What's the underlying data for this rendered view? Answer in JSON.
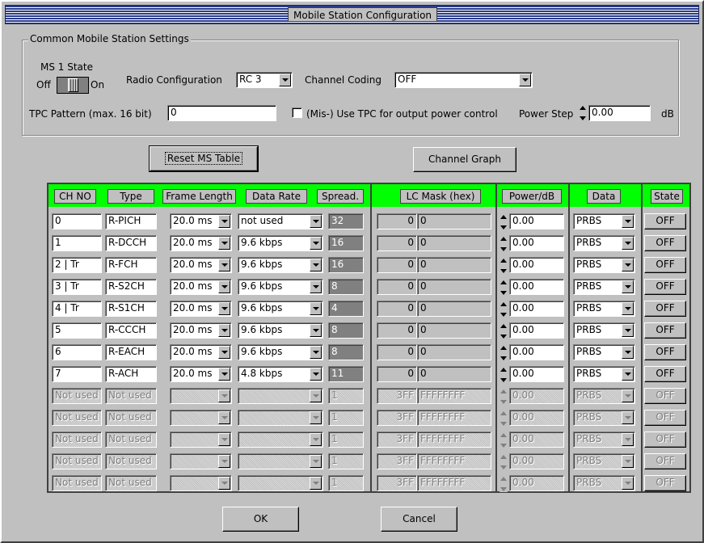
{
  "window": {
    "title": "Mobile Station Configuration"
  },
  "common": {
    "group_title": "Common Mobile Station Settings",
    "ms_state": {
      "label": "MS 1 State",
      "off": "Off",
      "on": "On"
    },
    "radio_config": {
      "label": "Radio Configuration",
      "value": "RC 3"
    },
    "channel_coding": {
      "label": "Channel Coding",
      "value": "OFF"
    },
    "tpc_pattern": {
      "label": "TPC Pattern (max. 16 bit)",
      "value": "0"
    },
    "mis_use_tpc": {
      "label": "(Mis-) Use TPC for output power control",
      "checked": false
    },
    "power_step": {
      "label": "Power Step",
      "value": "0.00",
      "unit": "dB"
    }
  },
  "buttons": {
    "reset": "Reset MS Table",
    "graph": "Channel Graph",
    "ok": "OK",
    "cancel": "Cancel"
  },
  "table": {
    "headers": {
      "ch_no": "CH NO",
      "type": "Type",
      "frame_length": "Frame Length",
      "data_rate": "Data Rate",
      "spread": "Spread.",
      "lc_mask": "LC Mask (hex)",
      "power": "Power/dB",
      "data": "Data",
      "state": "State"
    },
    "rows": [
      {
        "ch": "0",
        "type": "R-PICH",
        "frame": "20.0 ms",
        "rate": "not used",
        "spread": "32",
        "lc_a": "0",
        "lc_b": "0",
        "power": "0.00",
        "data": "PRBS",
        "state": "OFF"
      },
      {
        "ch": "1",
        "type": "R-DCCH",
        "frame": "20.0 ms",
        "rate": "9.6 kbps",
        "spread": "16",
        "lc_a": "0",
        "lc_b": "0",
        "power": "0.00",
        "data": "PRBS",
        "state": "OFF"
      },
      {
        "ch": "2 | Tr",
        "type": "R-FCH",
        "frame": "20.0 ms",
        "rate": "9.6 kbps",
        "spread": "16",
        "lc_a": "0",
        "lc_b": "0",
        "power": "0.00",
        "data": "PRBS",
        "state": "OFF"
      },
      {
        "ch": "3 | Tr",
        "type": "R-S2CH",
        "frame": "20.0 ms",
        "rate": "9.6 kbps",
        "spread": "8",
        "lc_a": "0",
        "lc_b": "0",
        "power": "0.00",
        "data": "PRBS",
        "state": "OFF"
      },
      {
        "ch": "4 | Tr",
        "type": "R-S1CH",
        "frame": "20.0 ms",
        "rate": "9.6 kbps",
        "spread": "4",
        "lc_a": "0",
        "lc_b": "0",
        "power": "0.00",
        "data": "PRBS",
        "state": "OFF"
      },
      {
        "ch": "5",
        "type": "R-CCCH",
        "frame": "20.0 ms",
        "rate": "9.6 kbps",
        "spread": "8",
        "lc_a": "0",
        "lc_b": "0",
        "power": "0.00",
        "data": "PRBS",
        "state": "OFF"
      },
      {
        "ch": "6",
        "type": "R-EACH",
        "frame": "20.0 ms",
        "rate": "9.6 kbps",
        "spread": "8",
        "lc_a": "0",
        "lc_b": "0",
        "power": "0.00",
        "data": "PRBS",
        "state": "OFF"
      },
      {
        "ch": "7",
        "type": "R-ACH",
        "frame": "20.0 ms",
        "rate": "4.8 kbps",
        "spread": "11",
        "lc_a": "0",
        "lc_b": "0",
        "power": "0.00",
        "data": "PRBS",
        "state": "OFF"
      }
    ],
    "disabled_rows": [
      {
        "ch": "Not used",
        "type": "Not used",
        "spread": "1",
        "lc_a": "3FF",
        "lc_b": "FFFFFFFF",
        "power": "0.00",
        "data": "PRBS",
        "state": "OFF"
      },
      {
        "ch": "Not used",
        "type": "Not used",
        "spread": "1",
        "lc_a": "3FF",
        "lc_b": "FFFFFFFF",
        "power": "0.00",
        "data": "PRBS",
        "state": "OFF"
      },
      {
        "ch": "Not used",
        "type": "Not used",
        "spread": "1",
        "lc_a": "3FF",
        "lc_b": "FFFFFFFF",
        "power": "0.00",
        "data": "PRBS",
        "state": "OFF"
      },
      {
        "ch": "Not used",
        "type": "Not used",
        "spread": "1",
        "lc_a": "3FF",
        "lc_b": "FFFFFFFF",
        "power": "0.00",
        "data": "PRBS",
        "state": "OFF"
      },
      {
        "ch": "Not used",
        "type": "Not used",
        "spread": "1",
        "lc_a": "3FF",
        "lc_b": "FFFFFFFF",
        "power": "0.00",
        "data": "PRBS",
        "state": "OFF"
      }
    ]
  },
  "colors": {
    "header_bar": "#00ff00",
    "title_stripes": "#2a3c8c",
    "face": "#c0c0c0"
  }
}
